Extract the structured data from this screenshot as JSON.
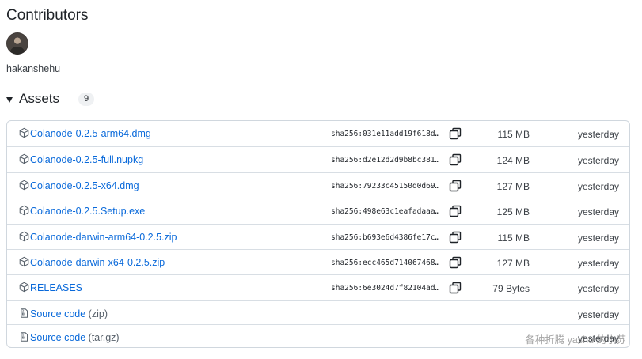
{
  "contributors": {
    "title": "Contributors",
    "users": [
      {
        "name": "hakanshehu"
      }
    ]
  },
  "assets": {
    "title": "Assets",
    "count": "9",
    "rows": [
      {
        "name": "Colanode-0.2.5-arm64.dmg",
        "sha": "sha256:031e11add19f618d…",
        "size": "115 MB",
        "date": "yesterday"
      },
      {
        "name": "Colanode-0.2.5-full.nupkg",
        "sha": "sha256:d2e12d2d9b8bc381…",
        "size": "124 MB",
        "date": "yesterday"
      },
      {
        "name": "Colanode-0.2.5-x64.dmg",
        "sha": "sha256:79233c45150d0d69…",
        "size": "127 MB",
        "date": "yesterday"
      },
      {
        "name": "Colanode-0.2.5.Setup.exe",
        "sha": "sha256:498e63c1eafadaaa…",
        "size": "125 MB",
        "date": "yesterday"
      },
      {
        "name": "Colanode-darwin-arm64-0.2.5.zip",
        "sha": "sha256:b693e6d4386fe17c…",
        "size": "115 MB",
        "date": "yesterday"
      },
      {
        "name": "Colanode-darwin-x64-0.2.5.zip",
        "sha": "sha256:ecc465d714067468…",
        "size": "127 MB",
        "date": "yesterday"
      },
      {
        "name": "RELEASES",
        "sha": "sha256:6e3024d7f82104ad…",
        "size": "79 Bytes",
        "date": "yesterday"
      }
    ],
    "source_rows": [
      {
        "label": "Source code",
        "suffix": "(zip)",
        "date": "yesterday"
      },
      {
        "label": "Source code",
        "suffix": "(tar.gz)",
        "date": "yesterday"
      }
    ]
  },
  "watermark": "各种折腾 yashu 的小苏",
  "colors": {
    "link": "#0969da",
    "border": "#d0d7de"
  },
  "icons": {
    "asset": "package-icon",
    "source": "file-zip-icon",
    "copy": "copy-icon"
  }
}
